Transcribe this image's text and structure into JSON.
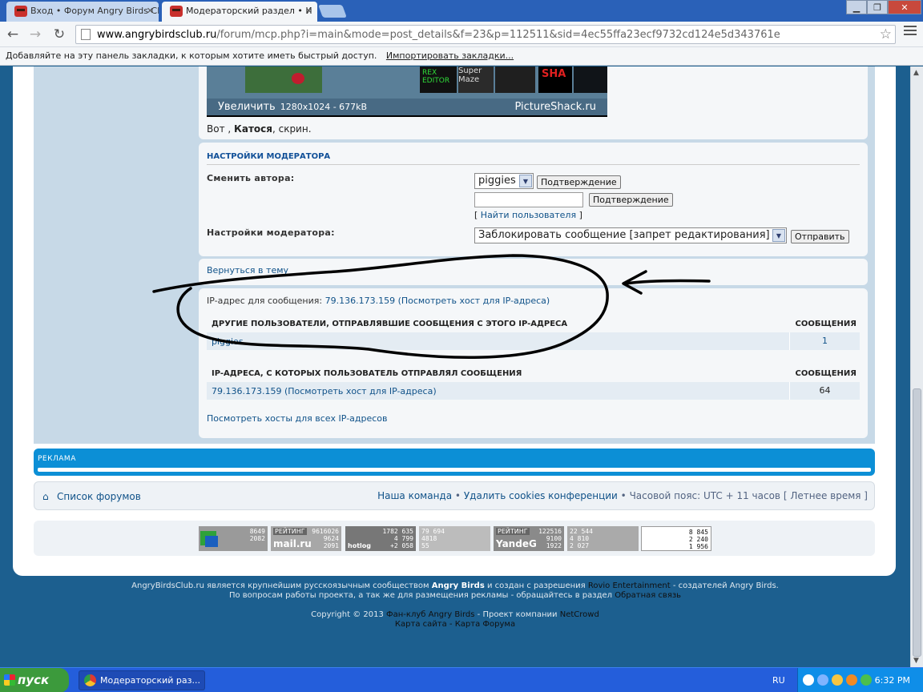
{
  "browser": {
    "tabs": [
      {
        "title": "Вход • Форум Angry Birds Club",
        "active": false
      },
      {
        "title": "Модераторский раздел • И",
        "active": true
      }
    ],
    "url_host": "www.angrybirdsclub.ru",
    "url_path": "/forum/mcp.php?i=main&mode=post_details&f=23&p=112511&sid=4ec55ffa23ecf9732cd124e5d343761e",
    "bookmarks_text": "Добавляйте на эту панель закладки, к которым хотите иметь быстрый доступ.",
    "bookmarks_import": "Импортировать закладки...",
    "icons": {
      "back": "back-arrow-icon",
      "forward": "forward-arrow-icon",
      "reload": "reload-icon",
      "star": "star-icon",
      "menu": "menu-icon"
    }
  },
  "post": {
    "image_enlarge": "Увеличить",
    "image_size": "1280x1024 - 677kB",
    "image_brand": "PictureShack.ru",
    "thumb_text_2": "REX EDITOR",
    "thumb_text_3": "Super Maze",
    "thumb_text_5": "SHA",
    "text_prefix": "Вот ,",
    "text_name": "Катося",
    "text_suffix": ", скрин."
  },
  "moderator": {
    "title": "НАСТРОЙКИ МОДЕРАТОРА",
    "change_author_label": "Сменить автора:",
    "author_value": "piggies",
    "confirm_label": "Подтверждение",
    "find_user_open": "[",
    "find_user": "Найти пользователя",
    "find_user_close": "]",
    "mod_options_label": "Настройки модератора:",
    "mod_action_value": "Заблокировать сообщение [запрет редактирования]",
    "send_label": "Отправить"
  },
  "back_to_topic": "Вернуться в тему",
  "ip_info": {
    "ip_label": "IP-адрес для сообщения:",
    "ip_value": "79.136.173.159",
    "ip_host_link": "(Посмотреть хост для IP-адреса)",
    "users_header": "ДРУГИЕ ПОЛЬЗОВАТЕЛИ, ОТПРАВЛЯВШИЕ СООБЩЕНИЯ С ЭТОГО IP-АДРЕСА",
    "posts_header": "СООБЩЕНИЯ",
    "users_rows": [
      {
        "name": "piggies",
        "count": "1"
      }
    ],
    "ips_header": "IP-АДРЕСА, С КОТОРЫХ ПОЛЬЗОВАТЕЛЬ ОТПРАВЛЯЛ СООБЩЕНИЯ",
    "ips_rows": [
      {
        "ip": "79.136.173.159 (Посмотреть хост для IP-адреса)",
        "count": "64"
      }
    ],
    "all_hosts_link": "Посмотреть хосты для всех IP-адресов"
  },
  "ads_title": "РЕКЛАМА",
  "footer_nav": {
    "forum_list": "Список форумов",
    "team": "Наша команда",
    "sep": "•",
    "delete_cookies": "Удалить cookies конференции",
    "timezone": "Часовой пояс: UTC + 11 часов",
    "dst": "[ Летнее время ]"
  },
  "counters": [
    {
      "lines": [
        "8649",
        "2082"
      ],
      "cap": "",
      "brand": ""
    },
    {
      "lines": [
        "9616026",
        "9624",
        "2091"
      ],
      "cap": "РЕЙТИНГ",
      "brand": "mail.ru"
    },
    {
      "lines": [
        "1782 635",
        "4 799",
        "+2 058"
      ],
      "cap": "",
      "brand": "hotlog"
    },
    {
      "lines": [
        "79 694",
        "4818",
        "55"
      ],
      "cap": "",
      "brand": ""
    },
    {
      "lines": [
        "122516",
        "9100",
        "1922"
      ],
      "cap": "РЕЙТИНГ",
      "brand": "YandeG"
    },
    {
      "lines": [
        "22 544",
        "4 810",
        "2 027"
      ],
      "cap": "",
      "brand": ""
    },
    {
      "lines": [
        "8 845",
        "2 240",
        "1 956"
      ],
      "cap": "",
      "brand": ""
    }
  ],
  "site_footer": {
    "l1_a": "AngryBirdsClub.ru является крупнейшим русскоязычным сообществом",
    "l1_b": "Angry Birds",
    "l1_c": "и создан с разрешения",
    "l1_d": "Rovio Entertainment",
    "l1_e": "- создателей Angry Birds.",
    "l2_a": "По вопросам работы проекта, а так же для размещения рекламы - обращайтесь в раздел",
    "l2_b": "Обратная связь",
    "l3_a": "Copyright © 2013",
    "l3_b": "Фан-клуб Angry Birds",
    "l3_c": "- Проект компании",
    "l3_d": "NetCrowd",
    "l4_a": "Карта сайта",
    "l4_sep": "-",
    "l4_b": "Карта Форума"
  },
  "taskbar": {
    "start": "пуск",
    "task": "Модераторский раз...",
    "lang": "RU",
    "clock": "6:32 PM"
  },
  "colors": {
    "page_bg": "#1c5f8f",
    "link": "#105289",
    "ads_blue": "#0c8fd6",
    "annotation": "#000000"
  }
}
